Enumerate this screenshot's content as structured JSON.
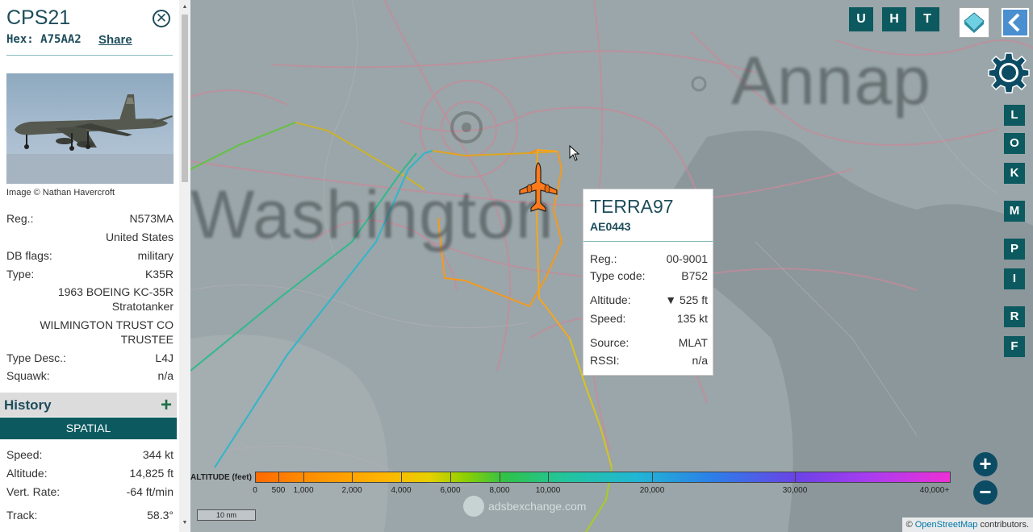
{
  "sidebar": {
    "callsign": "CPS21",
    "hex_label": "Hex:",
    "hex_value": "A75AA2",
    "share_label": "Share",
    "close_glyph": "✕",
    "photo_credit": "Image © Nathan Havercroft",
    "reg_label": "Reg.:",
    "reg_value": "N573MA",
    "country": "United States",
    "dbflags_label": "DB flags:",
    "dbflags_value": "military",
    "type_label": "Type:",
    "type_value": "K35R",
    "type_full_line1": "1963 BOEING KC-35R",
    "type_full_line2": "Stratotanker",
    "owner_line1": "WILMINGTON TRUST CO",
    "owner_line2": "TRUSTEE",
    "typedesc_label": "Type Desc.:",
    "typedesc_value": "L4J",
    "squawk_label": "Squawk:",
    "squawk_value": "n/a",
    "history_label": "History",
    "history_plus": "+",
    "spatial_label": "SPATIAL",
    "speed_label": "Speed:",
    "speed_value": "344 kt",
    "altitude_label": "Altitude:",
    "altitude_value": "14,825 ft",
    "vertrate_label": "Vert. Rate:",
    "vertrate_value": "-64 ft/min",
    "track_label": "Track:",
    "track_value": "58.3°"
  },
  "map": {
    "city_label_1": "Washington",
    "city_label_2": "Annap",
    "toolbar": [
      "U",
      "H",
      "T"
    ],
    "side_buttons": [
      "L",
      "O",
      "K",
      "M",
      "P",
      "I",
      "R",
      "F"
    ],
    "zoom_in": "+",
    "zoom_out": "−",
    "scale_label": "10 nm",
    "watermark": "adsbexchange.com",
    "attribution_prefix": "©",
    "attribution_link": "OpenStreetMap",
    "attribution_suffix": "contributors."
  },
  "popup": {
    "callsign": "TERRA97",
    "hex": "AE0443",
    "reg_label": "Reg.:",
    "reg_value": "00-9001",
    "typecode_label": "Type code:",
    "typecode_value": "B752",
    "altitude_label": "Altitude:",
    "altitude_value": "▼ 525 ft",
    "speed_label": "Speed:",
    "speed_value": "135 kt",
    "source_label": "Source:",
    "source_value": "MLAT",
    "rssi_label": "RSSI:",
    "rssi_value": "n/a"
  },
  "legend": {
    "title": "ALTITUDE (feet)",
    "labels": [
      "0",
      "500",
      "1,000",
      "2,000",
      "4,000",
      "6,000",
      "8,000",
      "10,000",
      "20,000",
      "30,000",
      "40,000+"
    ]
  },
  "colors": {
    "accent": "#0c5a60",
    "title_text": "#1e4d5c",
    "aircraft": "#ff7a1a"
  },
  "icons": [
    "close-icon",
    "layers-icon",
    "back-arrow-icon",
    "gear-icon",
    "aircraft-icon",
    "plus-icon",
    "minus-icon"
  ]
}
